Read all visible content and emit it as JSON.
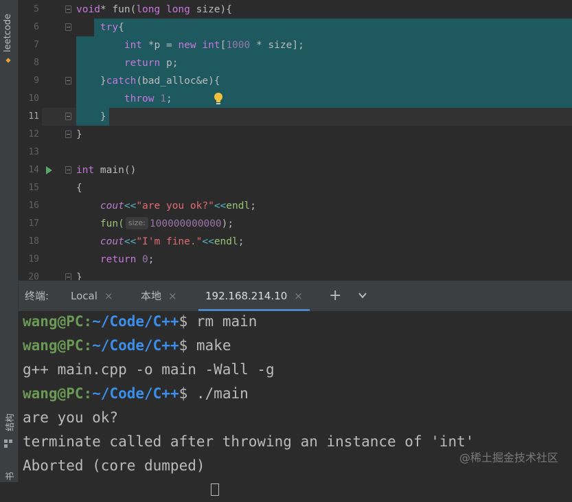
{
  "sidebar": {
    "project_label": "leetcode",
    "structure_label": "结构",
    "bookmarks_label": "书"
  },
  "editor": {
    "lines": [
      {
        "num": "5",
        "segments": [
          {
            "t": "void",
            "c": "kwp"
          },
          {
            "t": "* fun(",
            "c": ""
          },
          {
            "t": "long long",
            "c": "kwp"
          },
          {
            "t": " size){",
            "c": ""
          }
        ]
      },
      {
        "num": "6",
        "segments": [
          {
            "t": "    ",
            "c": ""
          },
          {
            "t": "try",
            "c": "kwp"
          },
          {
            "t": "{",
            "c": ""
          }
        ]
      },
      {
        "num": "7",
        "segments": [
          {
            "t": "        ",
            "c": ""
          },
          {
            "t": "int",
            "c": "kwp"
          },
          {
            "t": " *p = ",
            "c": ""
          },
          {
            "t": "new",
            "c": "kwp"
          },
          {
            "t": " ",
            "c": ""
          },
          {
            "t": "int",
            "c": "kwp"
          },
          {
            "t": "[",
            "c": ""
          },
          {
            "t": "1000",
            "c": "num"
          },
          {
            "t": " * size];",
            "c": ""
          }
        ]
      },
      {
        "num": "8",
        "segments": [
          {
            "t": "        ",
            "c": ""
          },
          {
            "t": "return",
            "c": "kwp"
          },
          {
            "t": " p;",
            "c": ""
          }
        ]
      },
      {
        "num": "9",
        "segments": [
          {
            "t": "    }",
            "c": ""
          },
          {
            "t": "catch",
            "c": "kwp"
          },
          {
            "t": "(bad_alloc&e){",
            "c": ""
          }
        ]
      },
      {
        "num": "10",
        "segments": [
          {
            "t": "        ",
            "c": ""
          },
          {
            "t": "throw",
            "c": "kwp"
          },
          {
            "t": " ",
            "c": ""
          },
          {
            "t": "1",
            "c": "num"
          },
          {
            "t": ";",
            "c": ""
          }
        ]
      },
      {
        "num": "11",
        "segments": [
          {
            "t": "    }",
            "c": ""
          }
        ]
      },
      {
        "num": "12",
        "segments": [
          {
            "t": "}",
            "c": ""
          }
        ]
      },
      {
        "num": "13",
        "segments": []
      },
      {
        "num": "14",
        "segments": [
          {
            "t": "int",
            "c": "kwp"
          },
          {
            "t": " main()",
            "c": ""
          }
        ]
      },
      {
        "num": "15",
        "segments": [
          {
            "t": "{",
            "c": ""
          }
        ]
      },
      {
        "num": "16",
        "segments": [
          {
            "t": "    ",
            "c": ""
          },
          {
            "t": "cout",
            "c": "cout"
          },
          {
            "t": "<<",
            "c": "op"
          },
          {
            "t": "\"are you ok?\"",
            "c": "str"
          },
          {
            "t": "<<",
            "c": "op"
          },
          {
            "t": "endl",
            "c": "fn"
          },
          {
            "t": ";",
            "c": ""
          }
        ]
      },
      {
        "num": "17",
        "segments": [
          {
            "t": "    ",
            "c": ""
          },
          {
            "t": "fun(",
            "c": "fn"
          },
          {
            "t": "size:",
            "c": "hint"
          },
          {
            "t": "100000000000",
            "c": "num"
          },
          {
            "t": ");",
            "c": ""
          }
        ]
      },
      {
        "num": "18",
        "segments": [
          {
            "t": "    ",
            "c": ""
          },
          {
            "t": "cout",
            "c": "cout"
          },
          {
            "t": "<<",
            "c": "op"
          },
          {
            "t": "\"I'm fine.\"",
            "c": "str"
          },
          {
            "t": "<<",
            "c": "op"
          },
          {
            "t": "endl",
            "c": "fn"
          },
          {
            "t": ";",
            "c": ""
          }
        ]
      },
      {
        "num": "19",
        "segments": [
          {
            "t": "    ",
            "c": ""
          },
          {
            "t": "return",
            "c": "kwp"
          },
          {
            "t": " ",
            "c": ""
          },
          {
            "t": "0",
            "c": "num"
          },
          {
            "t": ";",
            "c": ""
          }
        ]
      },
      {
        "num": "20",
        "segments": [
          {
            "t": "}",
            "c": ""
          }
        ]
      }
    ],
    "current_line": "11"
  },
  "terminal_tabs": {
    "label": "终端:",
    "tabs": [
      {
        "label": "Local",
        "close": "×"
      },
      {
        "label": "本地",
        "close": "×"
      },
      {
        "label": "192.168.214.10",
        "close": "×"
      }
    ],
    "add_label": "+"
  },
  "terminal": {
    "prompt_user": "wang@PC",
    "prompt_path": "~/Code/C++",
    "lines": [
      {
        "kind": "prompt",
        "cmd": " rm main"
      },
      {
        "kind": "prompt",
        "cmd": " make"
      },
      {
        "kind": "out",
        "text": "g++ main.cpp -o main -Wall -g"
      },
      {
        "kind": "prompt",
        "cmd": " ./main"
      },
      {
        "kind": "out",
        "text": "are you ok?"
      },
      {
        "kind": "out",
        "text": "terminate called after throwing an instance of 'int'"
      },
      {
        "kind": "out",
        "text": "Aborted (core dumped)"
      }
    ]
  },
  "watermark": "@稀土掘金技术社区",
  "colors": {
    "selection": "#1f5960",
    "background": "#2b2b2b",
    "tab_active": "#4a88c7"
  }
}
